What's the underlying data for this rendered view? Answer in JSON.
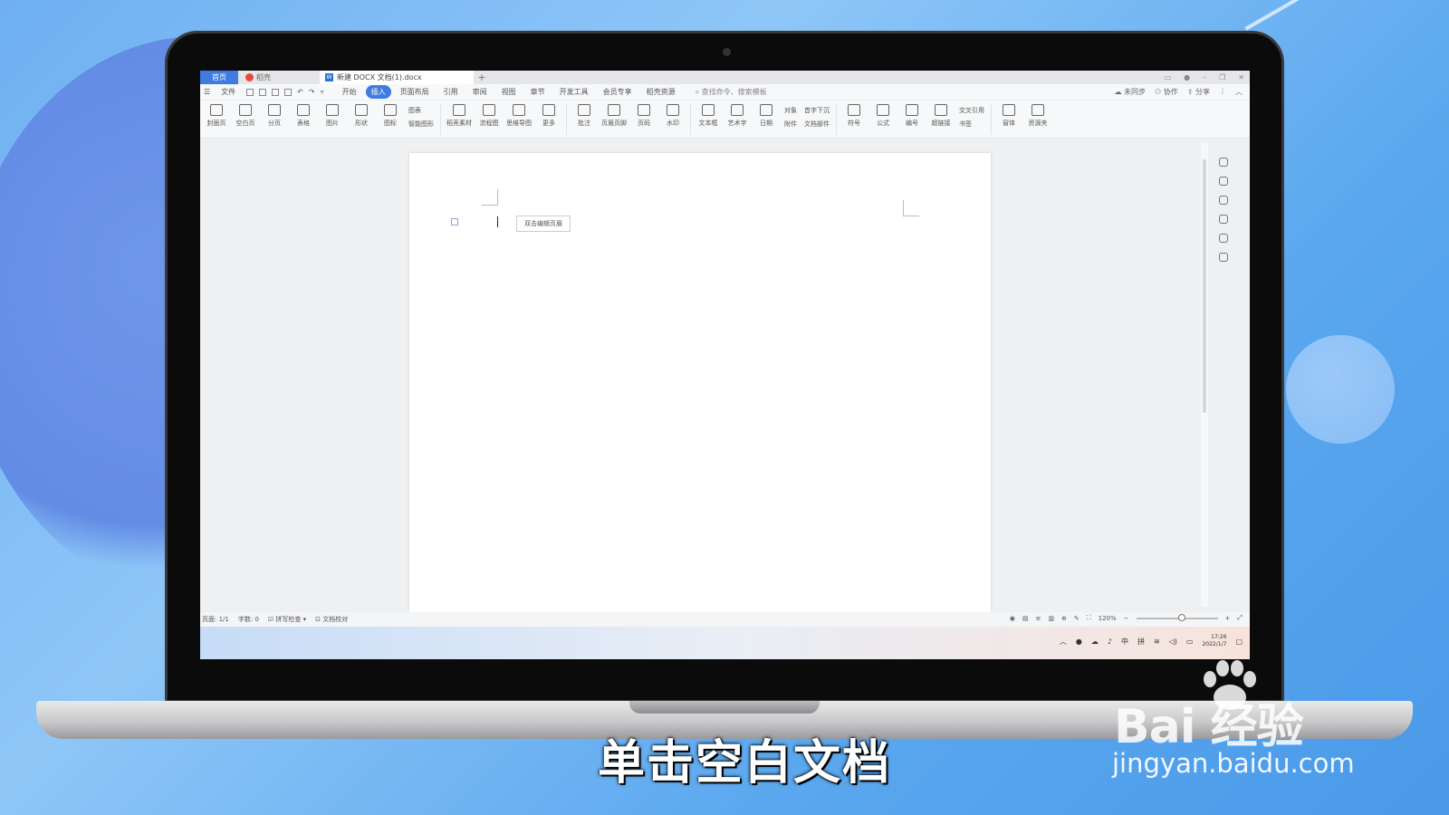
{
  "tabs": {
    "home": "首页",
    "daoke": "稻壳",
    "doc": "新建 DOCX 文档(1).docx",
    "add": "+"
  },
  "menu": {
    "file": "文件",
    "items": [
      "开始",
      "插入",
      "页面布局",
      "引用",
      "审阅",
      "视图",
      "章节",
      "开发工具",
      "会员专享",
      "稻壳资源"
    ],
    "active_index": 1,
    "search": "查找命令、搜索模板",
    "sync": "未同步",
    "collab": "协作",
    "share": "分享"
  },
  "ribbon": {
    "buttons": [
      "封面页",
      "空白页",
      "分页",
      "表格",
      "图片",
      "形状",
      "图标"
    ],
    "stack1": [
      "图表",
      "智能图形"
    ],
    "buttons2": [
      "稻壳素材",
      "流程图",
      "思维导图",
      "更多"
    ],
    "buttons3": [
      "批注",
      "页眉页脚",
      "页码",
      "水印"
    ],
    "buttons4": [
      "文本框",
      "艺术字",
      "日期"
    ],
    "stack2": [
      "对象",
      "附件"
    ],
    "stack3": [
      "首字下沉",
      "文档部件"
    ],
    "buttons5": [
      "符号",
      "公式",
      "编号",
      "超链接"
    ],
    "stack4": [
      "交叉引用",
      "书签"
    ],
    "buttons6": [
      "窗体",
      "资源夹"
    ]
  },
  "document": {
    "header_tip": "双击编辑页眉"
  },
  "status": {
    "page": "页面: 1/1",
    "words": "字数: 0",
    "spell": "拼写检查",
    "proof": "文档校对",
    "zoom": "120%"
  },
  "taskbar": {
    "ime1": "中",
    "ime2": "拼",
    "time": "17:26",
    "date": "2022/1/7"
  },
  "subtitle": "单击空白文档",
  "watermark": {
    "logo": "Bai 经验",
    "url": "jingyan.baidu.com"
  }
}
